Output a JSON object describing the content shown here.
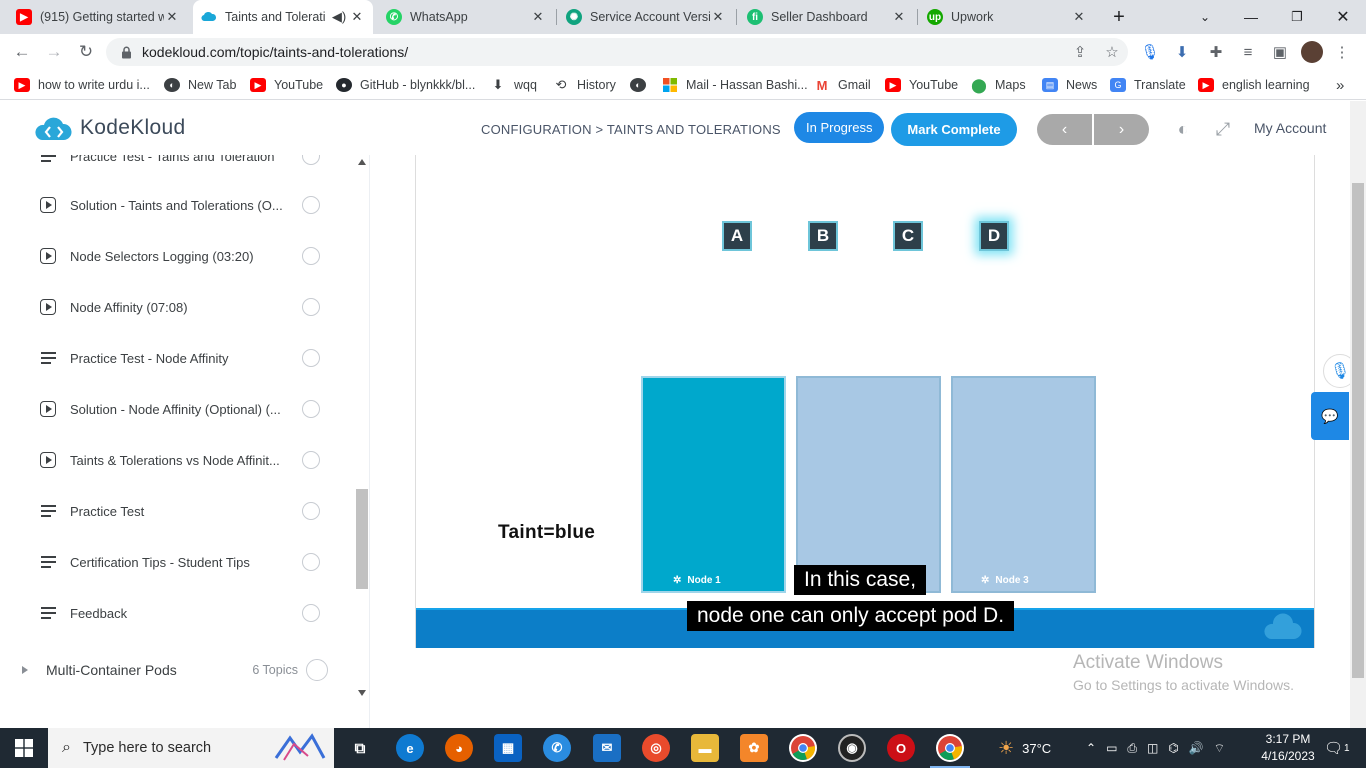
{
  "browser": {
    "tabs": [
      {
        "title": "(915) Getting started w",
        "favicon": "youtube-icon",
        "color": "#ff0000",
        "active": false
      },
      {
        "title": "Taints and Tolerati",
        "favicon": "kodekloud-icon",
        "color": "#1aa7d8",
        "active": true
      },
      {
        "title": "WhatsApp",
        "favicon": "whatsapp-icon",
        "color": "#25d366",
        "active": false
      },
      {
        "title": "Service Account Versic",
        "favicon": "openai-icon",
        "color": "#10a37f",
        "active": false
      },
      {
        "title": "Seller Dashboard",
        "favicon": "fiverr-icon",
        "color": "#1dbf73",
        "active": false
      },
      {
        "title": "Upwork",
        "favicon": "upwork-icon",
        "color": "#14a800",
        "active": false
      }
    ],
    "url": "kodekloud.com/topic/taints-and-tolerations/",
    "bookmarks": [
      {
        "label": "how to write urdu i...",
        "icon": "youtube-icon",
        "color": "#ff0000"
      },
      {
        "label": "New Tab",
        "icon": "globe-icon",
        "color": "#3c4043"
      },
      {
        "label": "YouTube",
        "icon": "youtube-icon",
        "color": "#ff0000"
      },
      {
        "label": "GitHub - blynkkk/bl...",
        "icon": "github-icon",
        "color": "#24292e"
      },
      {
        "label": "wqq",
        "icon": "download-icon",
        "color": "#3c4043"
      },
      {
        "label": "History",
        "icon": "history-icon",
        "color": "#3c4043"
      },
      {
        "label": "",
        "icon": "globe-icon",
        "color": "#3c4043"
      },
      {
        "label": "Mail - Hassan Bashi...",
        "icon": "microsoft-icon",
        "color": "#f25022"
      },
      {
        "label": "Gmail",
        "icon": "gmail-icon",
        "color": "#ea4335"
      },
      {
        "label": "YouTube",
        "icon": "youtube-icon",
        "color": "#ff0000"
      },
      {
        "label": "Maps",
        "icon": "maps-icon",
        "color": "#34a853"
      },
      {
        "label": "News",
        "icon": "news-icon",
        "color": "#4285f4"
      },
      {
        "label": "Translate",
        "icon": "translate-icon",
        "color": "#4285f4"
      },
      {
        "label": "english learning",
        "icon": "youtube-icon",
        "color": "#ff0000"
      }
    ]
  },
  "header": {
    "logo_text": "KodeKloud",
    "breadcrumb": "CONFIGURATION > TAINTS AND TOLERATIONS",
    "status_label": "In Progress",
    "complete_label": "Mark Complete",
    "prev_label": "‹",
    "next_label": "›",
    "account_label": "My Account"
  },
  "sidebar": {
    "items": [
      {
        "label": "Practice Test - Taints and Toleration",
        "type": "list"
      },
      {
        "label": "Solution - Taints and Tolerations (O...",
        "type": "video"
      },
      {
        "label": "Node Selectors Logging (03:20)",
        "type": "video"
      },
      {
        "label": "Node Affinity (07:08)",
        "type": "video"
      },
      {
        "label": "Practice Test - Node Affinity",
        "type": "list"
      },
      {
        "label": "Solution - Node Affinity (Optional) (...",
        "type": "video"
      },
      {
        "label": "Taints & Tolerations vs Node Affinit...",
        "type": "video"
      },
      {
        "label": "Practice Test",
        "type": "list"
      },
      {
        "label": "Certification Tips - Student Tips",
        "type": "list"
      },
      {
        "label": "Feedback",
        "type": "list"
      }
    ],
    "module": {
      "label": "Multi-Container Pods",
      "count": "6 Topics"
    }
  },
  "video": {
    "pods": [
      "A",
      "B",
      "C",
      "D"
    ],
    "nodes": [
      "Node 1",
      "",
      "Node 3"
    ],
    "taint_label": "Taint=blue",
    "subtitle_line1": "In this case,",
    "subtitle_line2": "node one can only accept pod D."
  },
  "watermark": {
    "line1": "Activate Windows",
    "line2": "Go to Settings to activate Windows."
  },
  "taskbar": {
    "search_placeholder": "Type here to search",
    "temperature": "37°C",
    "time": "3:17 PM",
    "date": "4/16/2023",
    "notification_count": "1"
  },
  "colors": {
    "accent": "#1e88e5",
    "node_active": "#00a8cc",
    "node_inactive": "#a8c8e4",
    "video_bar": "#0c7ec8"
  }
}
